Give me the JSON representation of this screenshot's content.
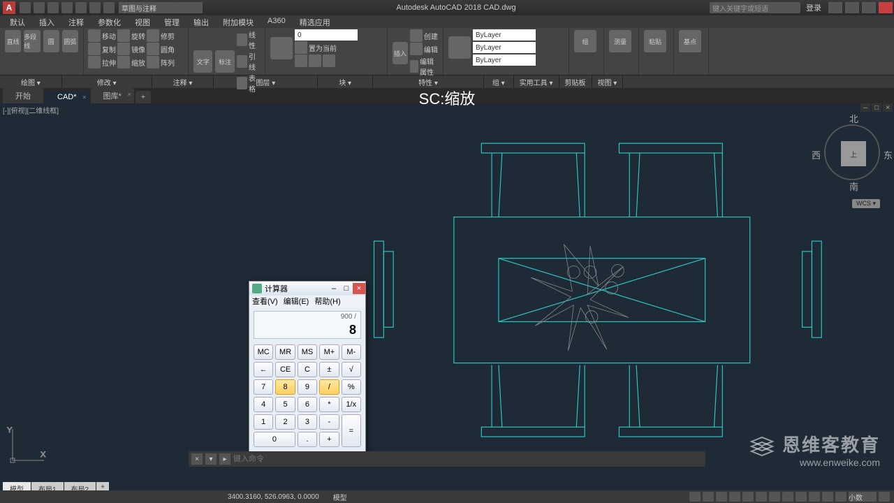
{
  "app": {
    "title": "Autodesk AutoCAD 2018    CAD.dwg",
    "logo": "A",
    "search_placeholder": "键入关键字或短语",
    "login": "登录"
  },
  "menubar": [
    "默认",
    "插入",
    "注释",
    "参数化",
    "视图",
    "管理",
    "输出",
    "附加模块",
    "A360",
    "精选应用"
  ],
  "qat_dropdown": "草图与注释",
  "ribbon_groups": [
    "绘图 ▾",
    "修改 ▾",
    "注释 ▾",
    "图层 ▾",
    "块 ▾",
    "特性 ▾",
    "组 ▾",
    "实用工具 ▾",
    "剪贴板",
    "视图 ▾"
  ],
  "ribbon": {
    "draw": {
      "line": "直线",
      "polyline": "多段线",
      "circle": "圆",
      "arc": "圆弧"
    },
    "modify": {
      "move": "移动",
      "rotate": "旋转",
      "trim": "修剪",
      "copy": "复制",
      "mirror": "镜像",
      "fillet": "圆角",
      "stretch": "拉伸",
      "scale": "缩放",
      "array": "阵列"
    },
    "annotate": {
      "text": "文字",
      "dim": "标注",
      "linear": "线性",
      "leader": "引线",
      "table": "表格"
    },
    "layer": {
      "props": "图层特性",
      "current": "0"
    },
    "block": {
      "insert": "插入",
      "create": "创建",
      "edit": "编辑",
      "attr": "编辑属性"
    },
    "props": {
      "bylayer1": "ByLayer",
      "bylayer2": "ByLayer",
      "bylayer3": "ByLayer",
      "match": "匹配"
    },
    "group": {
      "group": "组"
    },
    "util": {
      "measure": "测量"
    },
    "clip": {
      "paste": "粘贴"
    },
    "view": {
      "base": "基点"
    },
    "dangqian": "置为当前"
  },
  "tabs": [
    {
      "label": "开始",
      "active": false
    },
    {
      "label": "CAD*",
      "active": true
    },
    {
      "label": "图库*",
      "active": false
    }
  ],
  "canvas": {
    "title": "SC:缩放",
    "viewlabel": "[-][俯视][二维线框]"
  },
  "viewcube": {
    "n": "北",
    "s": "南",
    "e": "东",
    "w": "西",
    "top": "上",
    "wcs": "WCS ▾"
  },
  "calc": {
    "title": "计算器",
    "menu": [
      "查看(V)",
      "编辑(E)",
      "帮助(H)"
    ],
    "history": "900 /",
    "current": "8",
    "mem": [
      "MC",
      "MR",
      "MS",
      "M+",
      "M-"
    ],
    "row1": [
      "←",
      "CE",
      "C",
      "±",
      "√"
    ],
    "row2": [
      "7",
      "8",
      "9",
      "/",
      "%"
    ],
    "row3": [
      "4",
      "5",
      "6",
      "*",
      "1/x"
    ],
    "row4": [
      "1",
      "2",
      "3",
      "-"
    ],
    "row5": [
      "0",
      ".",
      "+"
    ],
    "equals": "="
  },
  "cmdline": {
    "placeholder": "键入命令"
  },
  "layout_tabs": [
    "模型",
    "布局1",
    "布局2"
  ],
  "status": {
    "coords": "3400.3160, 526.0963, 0.0000",
    "space": "模型",
    "scale": "小数"
  },
  "watermark": {
    "name": "恩维客教育",
    "url": "www.enweike.com"
  }
}
